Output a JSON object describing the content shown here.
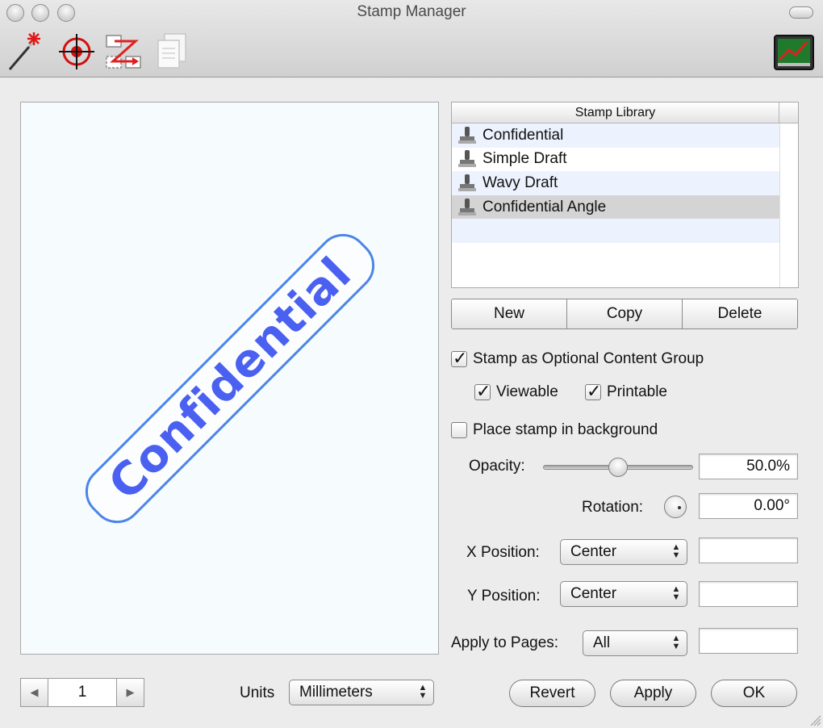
{
  "window": {
    "title": "Stamp Manager"
  },
  "toolbar": {
    "tools": [
      "wand-icon",
      "target-icon",
      "move-icon",
      "copy-page-icon"
    ],
    "right_tool": "chart-icon"
  },
  "preview": {
    "stamp_text": "Confidential",
    "stamp_color": "#4a60f0",
    "border_color": "#4a86e8"
  },
  "library": {
    "header": "Stamp Library",
    "items": [
      {
        "label": "Confidential"
      },
      {
        "label": "Simple Draft"
      },
      {
        "label": "Wavy Draft"
      },
      {
        "label": "Confidential Angle"
      }
    ],
    "selected_index": 3
  },
  "buttons": {
    "new": "New",
    "copy": "Copy",
    "delete": "Delete"
  },
  "options": {
    "optional_content_group": {
      "label": "Stamp as Optional Content Group",
      "checked": true
    },
    "viewable": {
      "label": "Viewable",
      "checked": true
    },
    "printable": {
      "label": "Printable",
      "checked": true
    },
    "background": {
      "label": "Place stamp in background",
      "checked": false
    }
  },
  "opacity": {
    "label": "Opacity:",
    "value": "50.0%",
    "level": 0.5
  },
  "rotation": {
    "label": "Rotation:",
    "value": "0.00°"
  },
  "x_position": {
    "label": "X Position:",
    "value": "Center",
    "extra": ""
  },
  "y_position": {
    "label": "Y Position:",
    "value": "Center",
    "extra": ""
  },
  "apply_pages": {
    "label": "Apply to Pages:",
    "value": "All",
    "extra": ""
  },
  "footer": {
    "page": "1",
    "units_label": "Units",
    "units_value": "Millimeters",
    "revert": "Revert",
    "apply": "Apply",
    "ok": "OK"
  }
}
